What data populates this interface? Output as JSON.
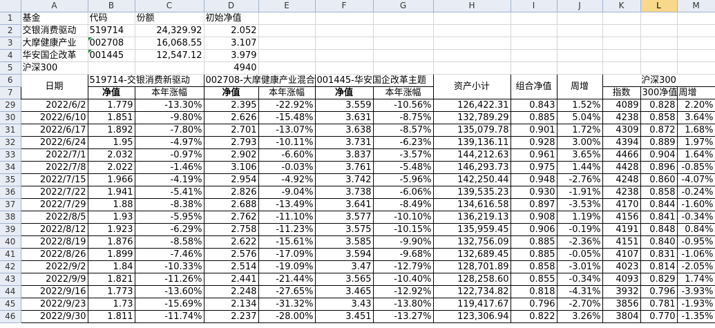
{
  "columns": [
    "A",
    "B",
    "C",
    "D",
    "E",
    "F",
    "G",
    "H",
    "I",
    "J",
    "K",
    "L",
    "M"
  ],
  "selected_column": "L",
  "info": {
    "rows": [
      {
        "rownum": "1",
        "a": "基金",
        "b": "代码",
        "c": "份额",
        "d": "初始净值"
      },
      {
        "rownum": "2",
        "a": "交银消费驱动",
        "b": "519714",
        "c": "24,329.92",
        "d": "2.052"
      },
      {
        "rownum": "3",
        "a": "大摩健康产业",
        "b": "002708",
        "c": "16,068.55",
        "d": "3.107"
      },
      {
        "rownum": "4",
        "a": "华安国企改革",
        "b": "001445",
        "c": "12,547.12",
        "d": "3.979"
      },
      {
        "rownum": "5",
        "a": "沪深300",
        "b": "",
        "c": "",
        "d": "4940"
      }
    ]
  },
  "header": {
    "row6": "6",
    "row7": "7",
    "date": "日期",
    "fund1": "519714-交银消费新驱动",
    "fund2": "002708-大摩健康产业混合",
    "fund3": "001445-华安国企改革主题",
    "assets": "资产小计",
    "combo": "组合净值",
    "weekly": "周增",
    "hs300": "沪深300",
    "nav": "净值",
    "ytd": "本年涨幅",
    "index": "指数",
    "nav300": "300净值",
    "weekly2": "周增"
  },
  "rows": [
    {
      "n": "29",
      "date": "2022/6/2",
      "v1": "1.779",
      "p1": "-13.30%",
      "v2": "2.395",
      "p2": "-22.92%",
      "v3": "3.559",
      "p3": "-10.56%",
      "total": "126,422.31",
      "combo": "0.843",
      "wk": "1.52%",
      "idx": "4089",
      "n300": "0.828",
      "wk2": "2.20%"
    },
    {
      "n": "30",
      "date": "2022/6/10",
      "v1": "1.851",
      "p1": "-9.80%",
      "v2": "2.626",
      "p2": "-15.48%",
      "v3": "3.631",
      "p3": "-8.75%",
      "total": "132,789.29",
      "combo": "0.885",
      "wk": "5.04%",
      "idx": "4238",
      "n300": "0.858",
      "wk2": "3.64%"
    },
    {
      "n": "31",
      "date": "2022/6/17",
      "v1": "1.892",
      "p1": "-7.80%",
      "v2": "2.701",
      "p2": "-13.07%",
      "v3": "3.638",
      "p3": "-8.57%",
      "total": "135,079.78",
      "combo": "0.901",
      "wk": "1.72%",
      "idx": "4309",
      "n300": "0.872",
      "wk2": "1.68%"
    },
    {
      "n": "32",
      "date": "2022/6/24",
      "v1": "1.95",
      "p1": "-4.97%",
      "v2": "2.793",
      "p2": "-10.11%",
      "v3": "3.731",
      "p3": "-6.23%",
      "total": "139,136.11",
      "combo": "0.928",
      "wk": "3.00%",
      "idx": "4394",
      "n300": "0.889",
      "wk2": "1.97%"
    },
    {
      "n": "33",
      "date": "2022/7/1",
      "v1": "2.032",
      "p1": "-0.97%",
      "v2": "2.902",
      "p2": "-6.60%",
      "v3": "3.837",
      "p3": "-3.57%",
      "total": "144,212.63",
      "combo": "0.961",
      "wk": "3.65%",
      "idx": "4466",
      "n300": "0.904",
      "wk2": "1.64%"
    },
    {
      "n": "34",
      "date": "2022/7/8",
      "v1": "2.022",
      "p1": "-1.46%",
      "v2": "3.106",
      "p2": "-0.03%",
      "v3": "3.761",
      "p3": "-5.48%",
      "total": "146,293.73",
      "combo": "0.975",
      "wk": "1.44%",
      "idx": "4428",
      "n300": "0.896",
      "wk2": "-0.85%"
    },
    {
      "n": "35",
      "date": "2022/7/15",
      "v1": "1.966",
      "p1": "-4.19%",
      "v2": "2.954",
      "p2": "-4.92%",
      "v3": "3.742",
      "p3": "-5.96%",
      "total": "142,250.44",
      "combo": "0.948",
      "wk": "-2.76%",
      "idx": "4248",
      "n300": "0.860",
      "wk2": "-4.07%"
    },
    {
      "n": "36",
      "date": "2022/7/22",
      "v1": "1.941",
      "p1": "-5.41%",
      "v2": "2.826",
      "p2": "-9.04%",
      "v3": "3.738",
      "p3": "-6.06%",
      "total": "139,535.23",
      "combo": "0.930",
      "wk": "-1.91%",
      "idx": "4238",
      "n300": "0.858",
      "wk2": "-0.24%"
    },
    {
      "n": "37",
      "date": "2022/7/29",
      "v1": "1.88",
      "p1": "-8.38%",
      "v2": "2.688",
      "p2": "-13.49%",
      "v3": "3.641",
      "p3": "-8.49%",
      "total": "134,616.58",
      "combo": "0.897",
      "wk": "-3.53%",
      "idx": "4170",
      "n300": "0.844",
      "wk2": "-1.60%"
    },
    {
      "n": "38",
      "date": "2022/8/5",
      "v1": "1.93",
      "p1": "-5.95%",
      "v2": "2.762",
      "p2": "-11.10%",
      "v3": "3.577",
      "p3": "-10.10%",
      "total": "136,219.13",
      "combo": "0.908",
      "wk": "1.19%",
      "idx": "4156",
      "n300": "0.841",
      "wk2": "-0.34%"
    },
    {
      "n": "39",
      "date": "2022/8/12",
      "v1": "1.923",
      "p1": "-6.29%",
      "v2": "2.758",
      "p2": "-11.23%",
      "v3": "3.575",
      "p3": "-10.15%",
      "total": "135,959.45",
      "combo": "0.906",
      "wk": "-0.19%",
      "idx": "4191",
      "n300": "0.848",
      "wk2": "0.84%"
    },
    {
      "n": "40",
      "date": "2022/8/19",
      "v1": "1.876",
      "p1": "-8.58%",
      "v2": "2.622",
      "p2": "-15.61%",
      "v3": "3.585",
      "p3": "-9.90%",
      "total": "132,756.09",
      "combo": "0.885",
      "wk": "-2.36%",
      "idx": "4151",
      "n300": "0.840",
      "wk2": "-0.95%"
    },
    {
      "n": "41",
      "date": "2022/8/26",
      "v1": "1.899",
      "p1": "-7.46%",
      "v2": "2.576",
      "p2": "-17.09%",
      "v3": "3.594",
      "p3": "-9.68%",
      "total": "132,689.45",
      "combo": "0.885",
      "wk": "-0.05%",
      "idx": "4107",
      "n300": "0.831",
      "wk2": "-1.06%"
    },
    {
      "n": "42",
      "date": "2022/9/2",
      "v1": "1.84",
      "p1": "-10.33%",
      "v2": "2.514",
      "p2": "-19.09%",
      "v3": "3.47",
      "p3": "-12.79%",
      "total": "128,701.89",
      "combo": "0.858",
      "wk": "-3.01%",
      "idx": "4023",
      "n300": "0.814",
      "wk2": "-2.05%"
    },
    {
      "n": "43",
      "date": "2022/9/9",
      "v1": "1.821",
      "p1": "-11.26%",
      "v2": "2.441",
      "p2": "-21.44%",
      "v3": "3.565",
      "p3": "-10.40%",
      "total": "128,258.60",
      "combo": "0.855",
      "wk": "-0.34%",
      "idx": "4093",
      "n300": "0.829",
      "wk2": "1.74%"
    },
    {
      "n": "44",
      "date": "2022/9/16",
      "v1": "1.773",
      "p1": "-13.60%",
      "v2": "2.248",
      "p2": "-27.65%",
      "v3": "3.465",
      "p3": "-12.92%",
      "total": "122,734.82",
      "combo": "0.818",
      "wk": "-4.31%",
      "idx": "3932",
      "n300": "0.796",
      "wk2": "-3.93%"
    },
    {
      "n": "45",
      "date": "2022/9/23",
      "v1": "1.73",
      "p1": "-15.69%",
      "v2": "2.134",
      "p2": "-31.32%",
      "v3": "3.43",
      "p3": "-13.80%",
      "total": "119,417.67",
      "combo": "0.796",
      "wk": "-2.70%",
      "idx": "3856",
      "n300": "0.781",
      "wk2": "-1.93%"
    },
    {
      "n": "46",
      "date": "2022/9/30",
      "v1": "1.811",
      "p1": "-11.74%",
      "v2": "2.237",
      "p2": "-28.00%",
      "v3": "3.451",
      "p3": "-13.27%",
      "total": "123,306.94",
      "combo": "0.822",
      "wk": "3.26%",
      "idx": "3804",
      "n300": "0.770",
      "wk2": "-1.35%"
    }
  ]
}
